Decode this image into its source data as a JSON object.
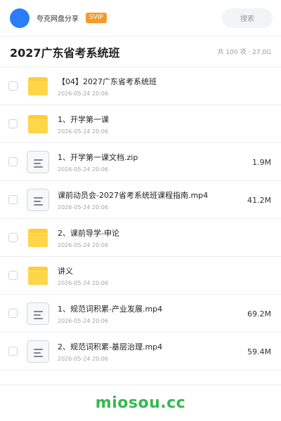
{
  "header": {
    "user_name": "夸克网盘分享",
    "badge": "SVIP",
    "search_label": "搜索"
  },
  "title_bar": {
    "title": "2027广东省考系统班",
    "summary": "共 100 项 · 27.0G"
  },
  "files": [
    {
      "type": "folder",
      "name": "【04】2027广东省考系统班",
      "date": "2026-05-24 20:06",
      "size": ""
    },
    {
      "type": "folder",
      "name": "1、开学第一课",
      "date": "2026-05-24 20:06",
      "size": ""
    },
    {
      "type": "file",
      "name": "1、开学第一课文档.zip",
      "date": "2026-05-24 20:06",
      "size": "1.9M"
    },
    {
      "type": "file",
      "name": "课前动员会-2027省考系统班课程指南.mp4",
      "date": "2026-05-24 20:06",
      "size": "41.2M"
    },
    {
      "type": "folder",
      "name": "2、课前导学-申论",
      "date": "2026-05-24 20:06",
      "size": ""
    },
    {
      "type": "folder",
      "name": "讲义",
      "date": "2026-05-24 20:06",
      "size": ""
    },
    {
      "type": "file",
      "name": "1、规范词积累-产业发展.mp4",
      "date": "2026-05-24 20:06",
      "size": "69.2M"
    },
    {
      "type": "file",
      "name": "2、规范词积累-基层治理.mp4",
      "date": "2026-05-24 20:06",
      "size": "59.4M"
    }
  ],
  "footer": {
    "watermark": "miosou.cc"
  },
  "colors": {
    "avatar": "#2a7cf7",
    "svip_badge": "#f59a2c",
    "folder": "#ffd54a",
    "watermark": "#35b84f"
  },
  "icons": {
    "folder": "folder-icon",
    "file": "document-icon"
  }
}
